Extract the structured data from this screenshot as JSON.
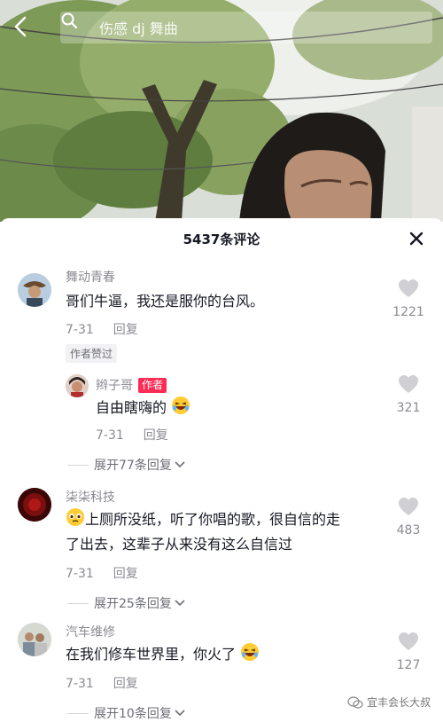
{
  "search": {
    "query": "伤感 dj 舞曲"
  },
  "sheet": {
    "title": "5437条评论"
  },
  "comments": [
    {
      "user": "舞动青春",
      "text": "哥们牛逼，我还是服你的台风。",
      "date": "7-31",
      "reply_label": "回复",
      "likes": "1221",
      "author_liked_badge": "作者赞过"
    },
    {
      "user": "辫子哥",
      "author_tag": "作者",
      "text": "自由瞎嗨的",
      "date": "7-31",
      "reply_label": "回复",
      "likes": "321",
      "expand_label": "展开77条回复"
    },
    {
      "user": "柒柒科技",
      "text_line1": "上厕所没纸，听了你唱的歌，很自信的走",
      "text_line2": "了出去，这辈子从来没有这么自信过",
      "date": "7-31",
      "reply_label": "回复",
      "likes": "483",
      "expand_label": "展开25条回复"
    },
    {
      "user": "汽车维修",
      "text": "在我们修车世界里，你火了",
      "date": "7-31",
      "reply_label": "回复",
      "likes": "127",
      "expand_label": "展开10条回复"
    }
  ],
  "watermark": {
    "text": "宜丰会长大叔"
  },
  "colors": {
    "accent": "#fe2c55",
    "muted": "#8a8b91",
    "heart": "#d0d0d4"
  },
  "icons": [
    "back-arrow-icon",
    "search-icon",
    "close-icon",
    "heart-icon",
    "chevron-down-icon",
    "laughing-emoji-icon",
    "worried-emoji-icon",
    "wechat-icon"
  ]
}
